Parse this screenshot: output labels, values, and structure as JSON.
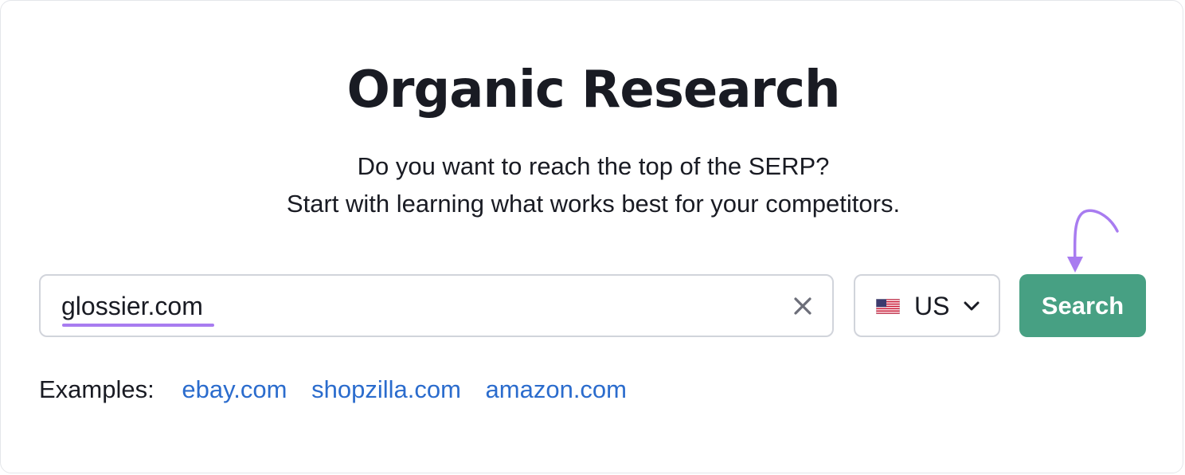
{
  "page": {
    "title": "Organic Research",
    "subtitle_line1": "Do you want to reach the top of the SERP?",
    "subtitle_line2": "Start with learning what works best for your competitors."
  },
  "search": {
    "value": "glossier.com",
    "clear_icon": "close-icon"
  },
  "country": {
    "flag_icon": "us-flag-icon",
    "selected": "US",
    "chevron_icon": "chevron-down-icon"
  },
  "search_button": {
    "label": "Search"
  },
  "annotation": {
    "arrow_icon": "curved-arrow-icon"
  },
  "examples": {
    "label": "Examples:",
    "links": [
      "ebay.com",
      "shopzilla.com",
      "amazon.com"
    ]
  },
  "colors": {
    "accent_button": "#47a083",
    "link": "#2b6ccd",
    "highlight": "#a87cf0",
    "text": "#191b23",
    "border": "#d1d4db"
  }
}
